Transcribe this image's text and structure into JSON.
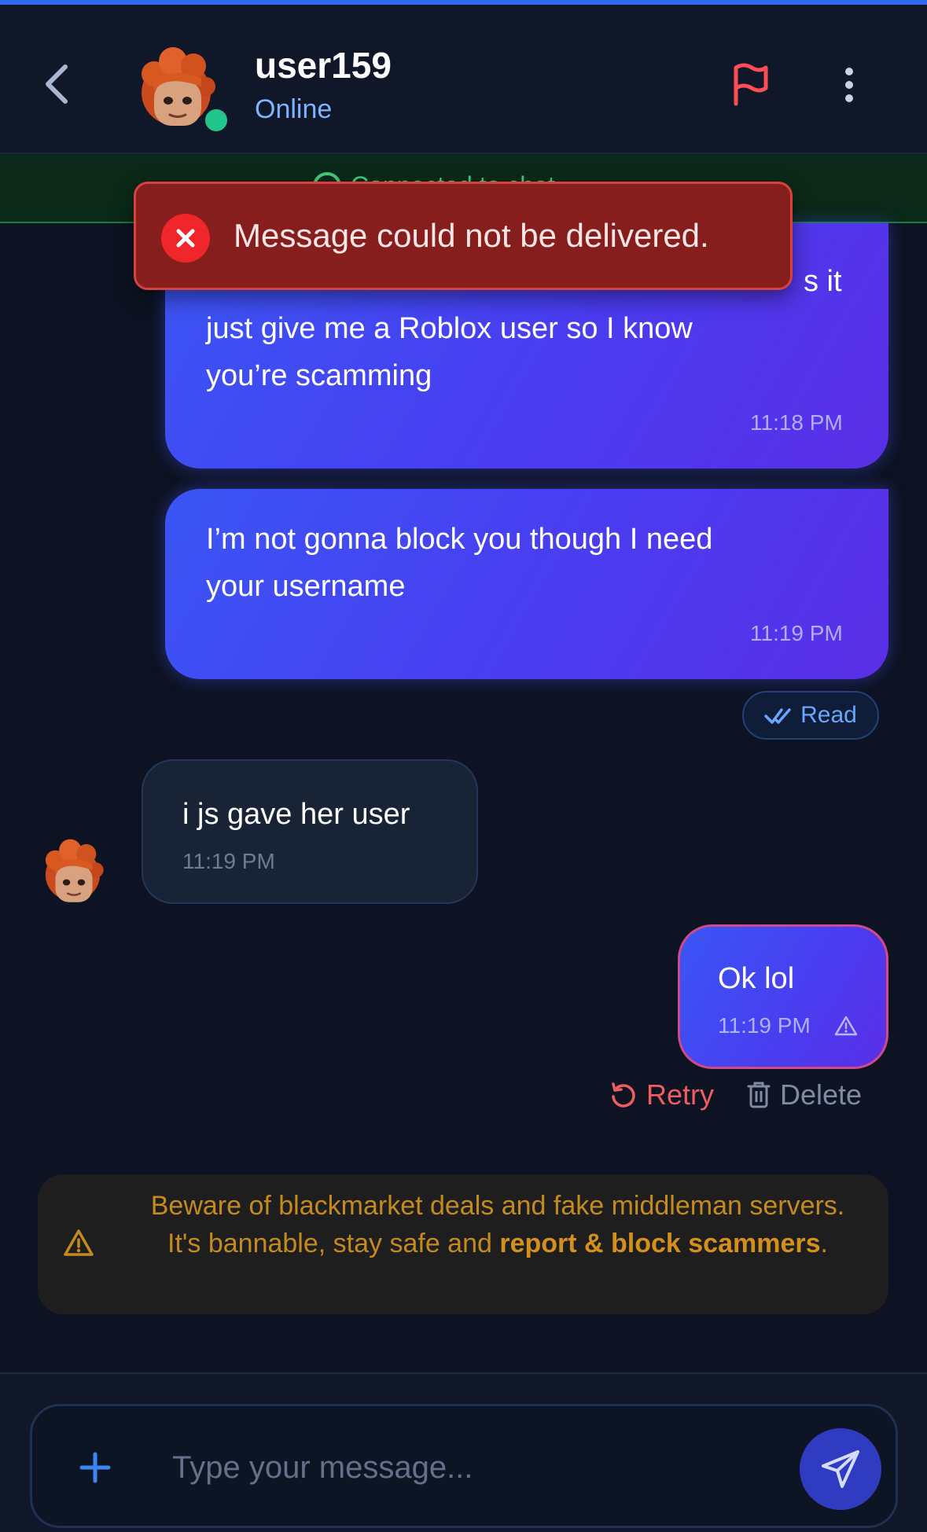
{
  "theme": {
    "background": "#0d1322",
    "accent": "#2f6af0",
    "online": "#22c58b",
    "error": "#f0262b",
    "warning": "#c58a1d"
  },
  "header": {
    "back_icon": "chevron-left-icon",
    "username": "user159",
    "status": "Online",
    "report_icon": "flag-icon",
    "more_icon": "more-vertical-icon"
  },
  "connection_banner": {
    "text": "Connected to chat"
  },
  "toast": {
    "icon": "x-circle-icon",
    "message": "Message could not be delivered."
  },
  "messages": [
    {
      "direction": "outgoing",
      "lines": [
        "just give me a Roblox user so I know",
        "you’re scamming"
      ],
      "partial_line": "s it",
      "time": "11:18 PM"
    },
    {
      "direction": "outgoing",
      "lines": [
        "I’m not gonna block you though I need",
        "your username"
      ],
      "time": "11:19 PM"
    },
    {
      "direction": "incoming",
      "text": "i js gave her user",
      "time": "11:19 PM"
    },
    {
      "direction": "outgoing",
      "text": "Ok lol",
      "time": "11:19 PM",
      "status": "failed"
    }
  ],
  "read_receipt": {
    "icon": "double-check-icon",
    "label": "Read"
  },
  "failed_actions": {
    "retry_label": "Retry",
    "delete_label": "Delete"
  },
  "warning": {
    "icon": "warning-triangle-icon",
    "text_before": "Beware of blackmarket deals and fake middleman servers. It's bannable, stay safe and ",
    "bold_text": "report & block scammers",
    "text_after": "."
  },
  "composer": {
    "add_icon": "plus-icon",
    "placeholder": "Type your message...",
    "send_icon": "send-icon"
  }
}
